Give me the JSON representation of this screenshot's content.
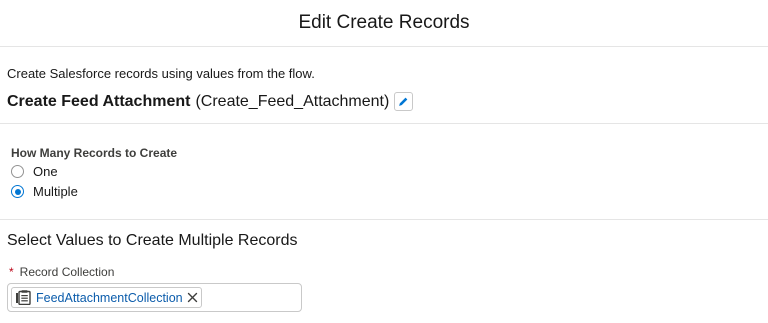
{
  "header": {
    "title": "Edit Create Records"
  },
  "element": {
    "description": "Create Salesforce records using values from the flow.",
    "label": "Create Feed Attachment",
    "api_name": "(Create_Feed_Attachment)",
    "edit_icon": "pencil-icon"
  },
  "how_many": {
    "label": "How Many Records to Create",
    "options": [
      {
        "label": "One",
        "selected": false
      },
      {
        "label": "Multiple",
        "selected": true
      }
    ]
  },
  "values_section": {
    "title": "Select Values to Create Multiple Records",
    "record_collection": {
      "required_marker": "*",
      "label": "Record Collection",
      "pill_label": "FeedAttachmentCollection",
      "pill_icon": "collection-icon",
      "remove_icon": "close-icon"
    }
  },
  "colors": {
    "accent": "#0176d3",
    "link": "#0b5cab",
    "required": "#ba0517",
    "border": "#c9c9c9"
  }
}
